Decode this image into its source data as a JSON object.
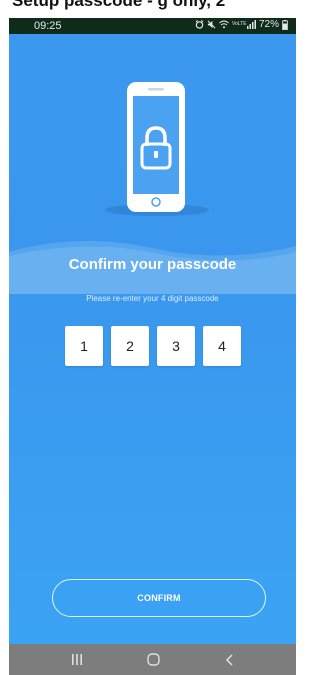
{
  "caption": {
    "text": "Setup passcode - g only, 2"
  },
  "status_bar": {
    "time": "09:25",
    "battery_percent": "72%",
    "icons": [
      "alarm-icon",
      "mute-icon",
      "wifi-icon",
      "volte-label",
      "signal-icon",
      "battery-icon"
    ],
    "volte": "VoLTE"
  },
  "screen": {
    "title": "Confirm your passcode",
    "subtitle": "Please re-enter your 4 digit passcode",
    "digits": [
      "1",
      "2",
      "3",
      "4"
    ],
    "confirm_label": "CONFIRM"
  },
  "navigation": {
    "buttons": [
      "recent-apps",
      "home",
      "back"
    ]
  },
  "colors": {
    "background_blue": "#3b98ee",
    "status_bar": "#0f2b1c",
    "nav_bar": "#7d7d7d"
  }
}
